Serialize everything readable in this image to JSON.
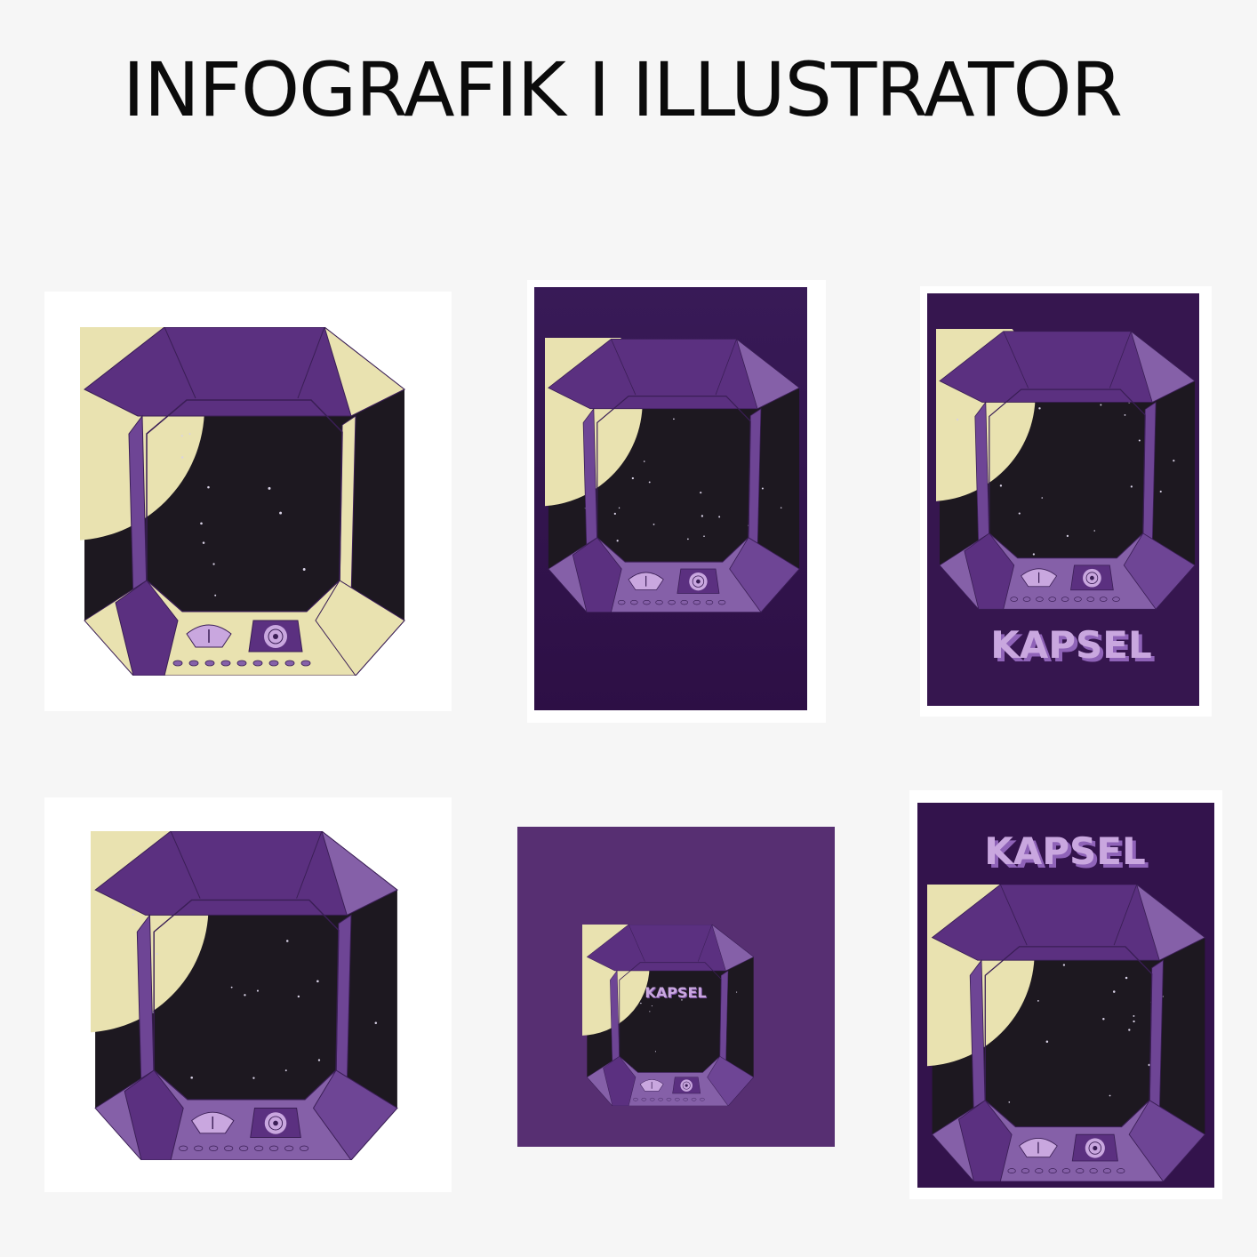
{
  "page": {
    "title": "INFOGRAFIK I ILLUSTRATOR"
  },
  "colors": {
    "background": "#f6f6f6",
    "card": "#ffffff",
    "poster_dark": "#2f1147",
    "poster_mid": "#572f72",
    "frame_dark": "#5b3080",
    "frame_mid": "#6e4595",
    "frame_light": "#8560a8",
    "moonlight": "#e9e2b0",
    "space": "#1d1820",
    "text_lilac": "#c9a7df"
  },
  "gallery": [
    {
      "name": "draft-with-moonlight",
      "type": "illustration",
      "has_title": false
    },
    {
      "name": "poster-dark-no-title",
      "type": "poster",
      "has_title": false
    },
    {
      "name": "poster-title-bottom",
      "type": "poster",
      "has_title": true,
      "title": "KAPSEL"
    },
    {
      "name": "illustration-final",
      "type": "illustration",
      "has_title": false
    },
    {
      "name": "poster-small-centered",
      "type": "poster",
      "has_title": true,
      "title": "KAPSEL"
    },
    {
      "name": "poster-title-top",
      "type": "poster",
      "has_title": true,
      "title": "KAPSEL"
    }
  ]
}
